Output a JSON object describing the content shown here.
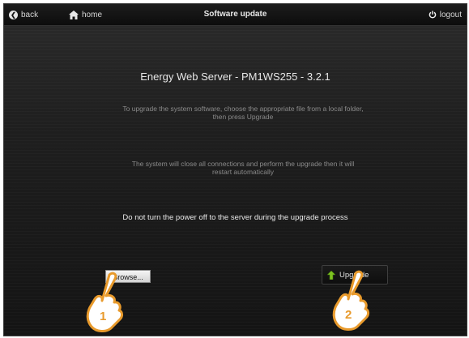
{
  "topbar": {
    "back_label": "back",
    "home_label": "home",
    "title": "Software update",
    "logout_label": "logout"
  },
  "main": {
    "heading": "Energy Web Server - PM1WS255 - 3.2.1",
    "instruction_line1": "To upgrade the system software, choose the appropriate file from a local folder,",
    "instruction_line2": "then press Upgrade",
    "restart_line1": "The system will close all connections and perform the upgrade then it will",
    "restart_line2": "restart automatically",
    "warning": "Do not turn the power off to the server during the upgrade process",
    "browse_label": "Browse...",
    "upgrade_label": "Upgrade"
  },
  "callouts": {
    "step1": "1",
    "step2": "2",
    "hand_color": "#e89a2c",
    "hand_fill": "#ffffff"
  },
  "colors": {
    "background": "#1e1e1e",
    "topbar": "#0d0d0d",
    "upgrade_arrow": "#7ec321"
  }
}
